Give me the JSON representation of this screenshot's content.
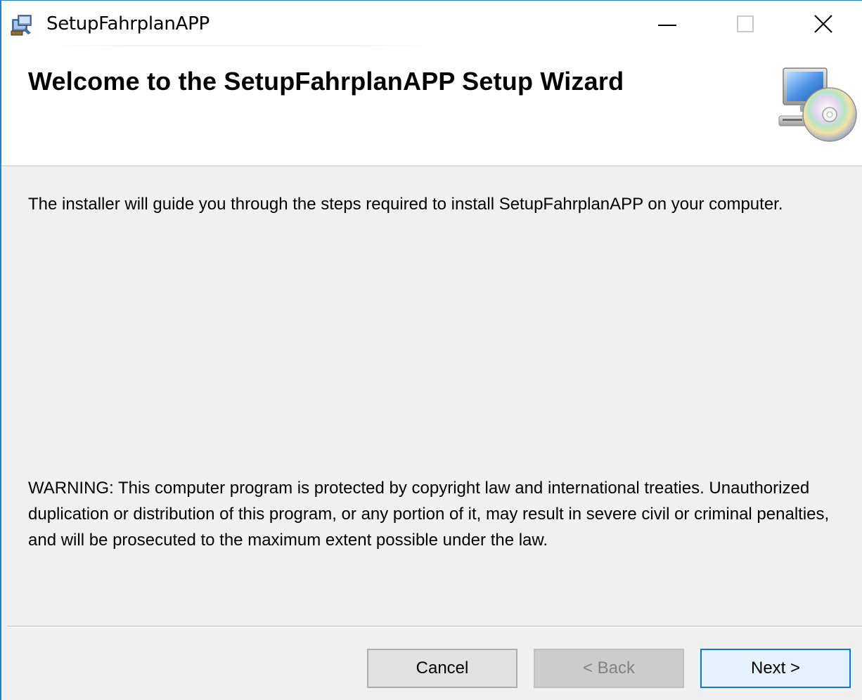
{
  "window": {
    "title": "SetupFahrplanAPP",
    "controls": {
      "minimize_icon": "minimize-icon",
      "maximize_icon": "maximize-icon",
      "close_icon": "close-icon"
    },
    "accent_color": "#1883d7"
  },
  "banner": {
    "title": "Welcome to the SetupFahrplanAPP Setup Wizard",
    "icon": "computer-cd-icon"
  },
  "body": {
    "intro": "The installer will guide you through the steps required to install SetupFahrplanAPP on your computer.",
    "warning": "WARNING: This computer program is protected by copyright law and international treaties. Unauthorized duplication or distribution of this program, or any portion of it, may result in severe civil or criminal penalties, and will be prosecuted to the maximum extent possible under the law."
  },
  "buttons": {
    "cancel": "Cancel",
    "back": "< Back",
    "next": "Next >"
  }
}
